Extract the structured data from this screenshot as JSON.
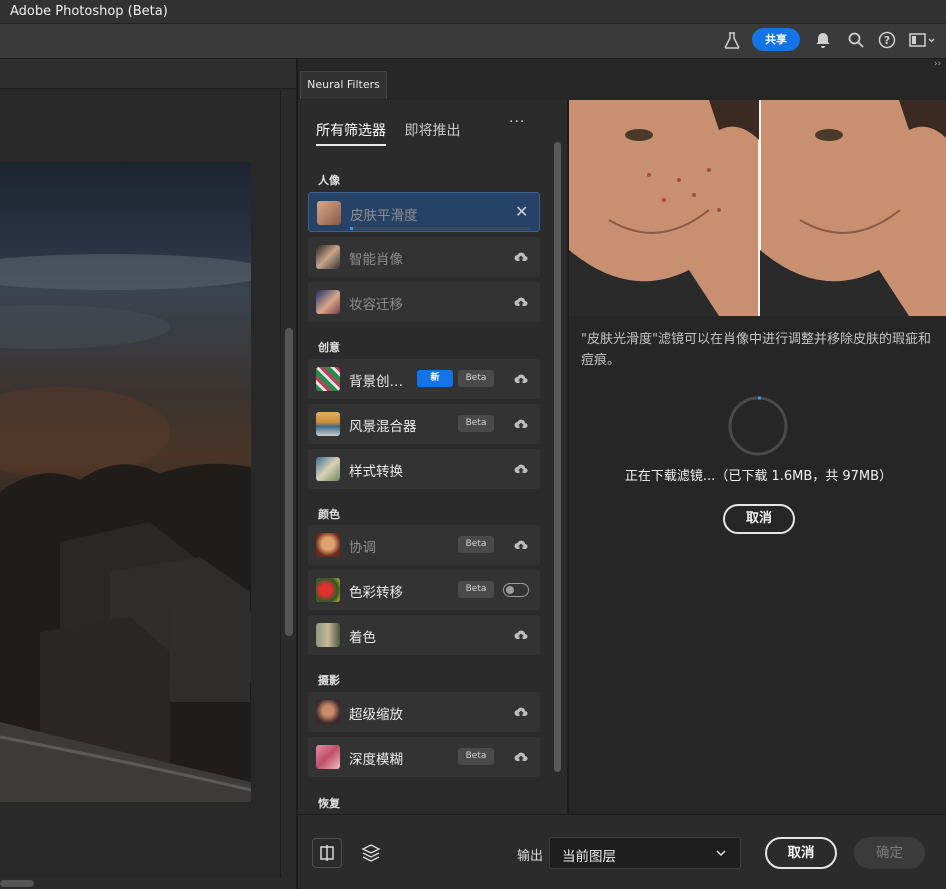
{
  "app": {
    "title": "Adobe Photoshop (Beta)"
  },
  "toolbar": {
    "share_label": "共享"
  },
  "panel": {
    "tab_label": "Neural Filters",
    "filter_tabs": [
      "所有筛选器",
      "即将推出"
    ],
    "more_label": "···",
    "sections": {
      "portrait": "人像",
      "creative": "创意",
      "color": "颜色",
      "photo": "摄影",
      "restore": "恢复"
    },
    "items": [
      {
        "label": "皮肤平滑度",
        "state": "downloading",
        "progress": 0.016
      },
      {
        "label": "智能肖像",
        "state": "cloud"
      },
      {
        "label": "妆容迁移",
        "state": "cloud"
      },
      {
        "label": "背景创…",
        "badge_new": "新",
        "badge": "Beta",
        "state": "cloud"
      },
      {
        "label": "风景混合器",
        "badge": "Beta",
        "state": "cloud"
      },
      {
        "label": "样式转换",
        "state": "cloud"
      },
      {
        "label": "协调",
        "badge": "Beta",
        "state": "cloud"
      },
      {
        "label": "色彩转移",
        "badge": "Beta",
        "state": "toggle-off"
      },
      {
        "label": "着色",
        "state": "cloud"
      },
      {
        "label": "超级缩放",
        "state": "cloud"
      },
      {
        "label": "深度模糊",
        "badge": "Beta",
        "state": "cloud"
      }
    ],
    "description": "\"皮肤光滑度\"滤镜可以在肖像中进行调整并移除皮肤的瑕疵和痘痕。",
    "download_status": "正在下载滤镜...（已下载 1.6MB，共 97MB）",
    "download_progress": 0.016,
    "cancel_label": "取消"
  },
  "footer": {
    "output_label": "输出",
    "output_value": "当前图层",
    "cancel_label": "取消",
    "ok_label": "确定"
  },
  "colors": {
    "accent": "#1473e6",
    "selected_item": "#264266",
    "progress": "#2d9cf5"
  }
}
